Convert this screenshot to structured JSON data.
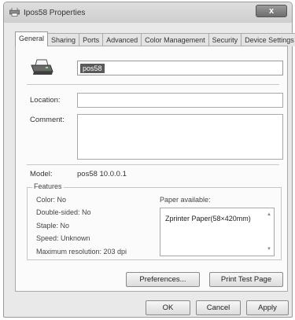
{
  "window": {
    "title": "Ipos58 Properties",
    "close_glyph": "x"
  },
  "tabs": [
    {
      "label": "General",
      "active": true
    },
    {
      "label": "Sharing"
    },
    {
      "label": "Ports"
    },
    {
      "label": "Advanced"
    },
    {
      "label": "Color Management"
    },
    {
      "label": "Security"
    },
    {
      "label": "Device Settings"
    }
  ],
  "general": {
    "printer_name": "pos58",
    "location_label": "Location:",
    "location_value": "",
    "comment_label": "Comment:",
    "comment_value": "",
    "model_label": "Model:",
    "model_value": "pos58 10.0.0.1",
    "features_legend": "Features",
    "features": {
      "color": "Color: No",
      "double_sided": "Double-sided: No",
      "staple": "Staple: No",
      "speed": "Speed: Unknown",
      "max_resolution": "Maximum resolution: 203 dpi"
    },
    "paper_available_label": "Paper available:",
    "paper_list": [
      "Zprinter Paper(58×420mm)"
    ],
    "preferences_button": "Preferences...",
    "print_test_page_button": "Print Test Page"
  },
  "footer": {
    "ok": "OK",
    "cancel": "Cancel",
    "apply": "Apply"
  }
}
